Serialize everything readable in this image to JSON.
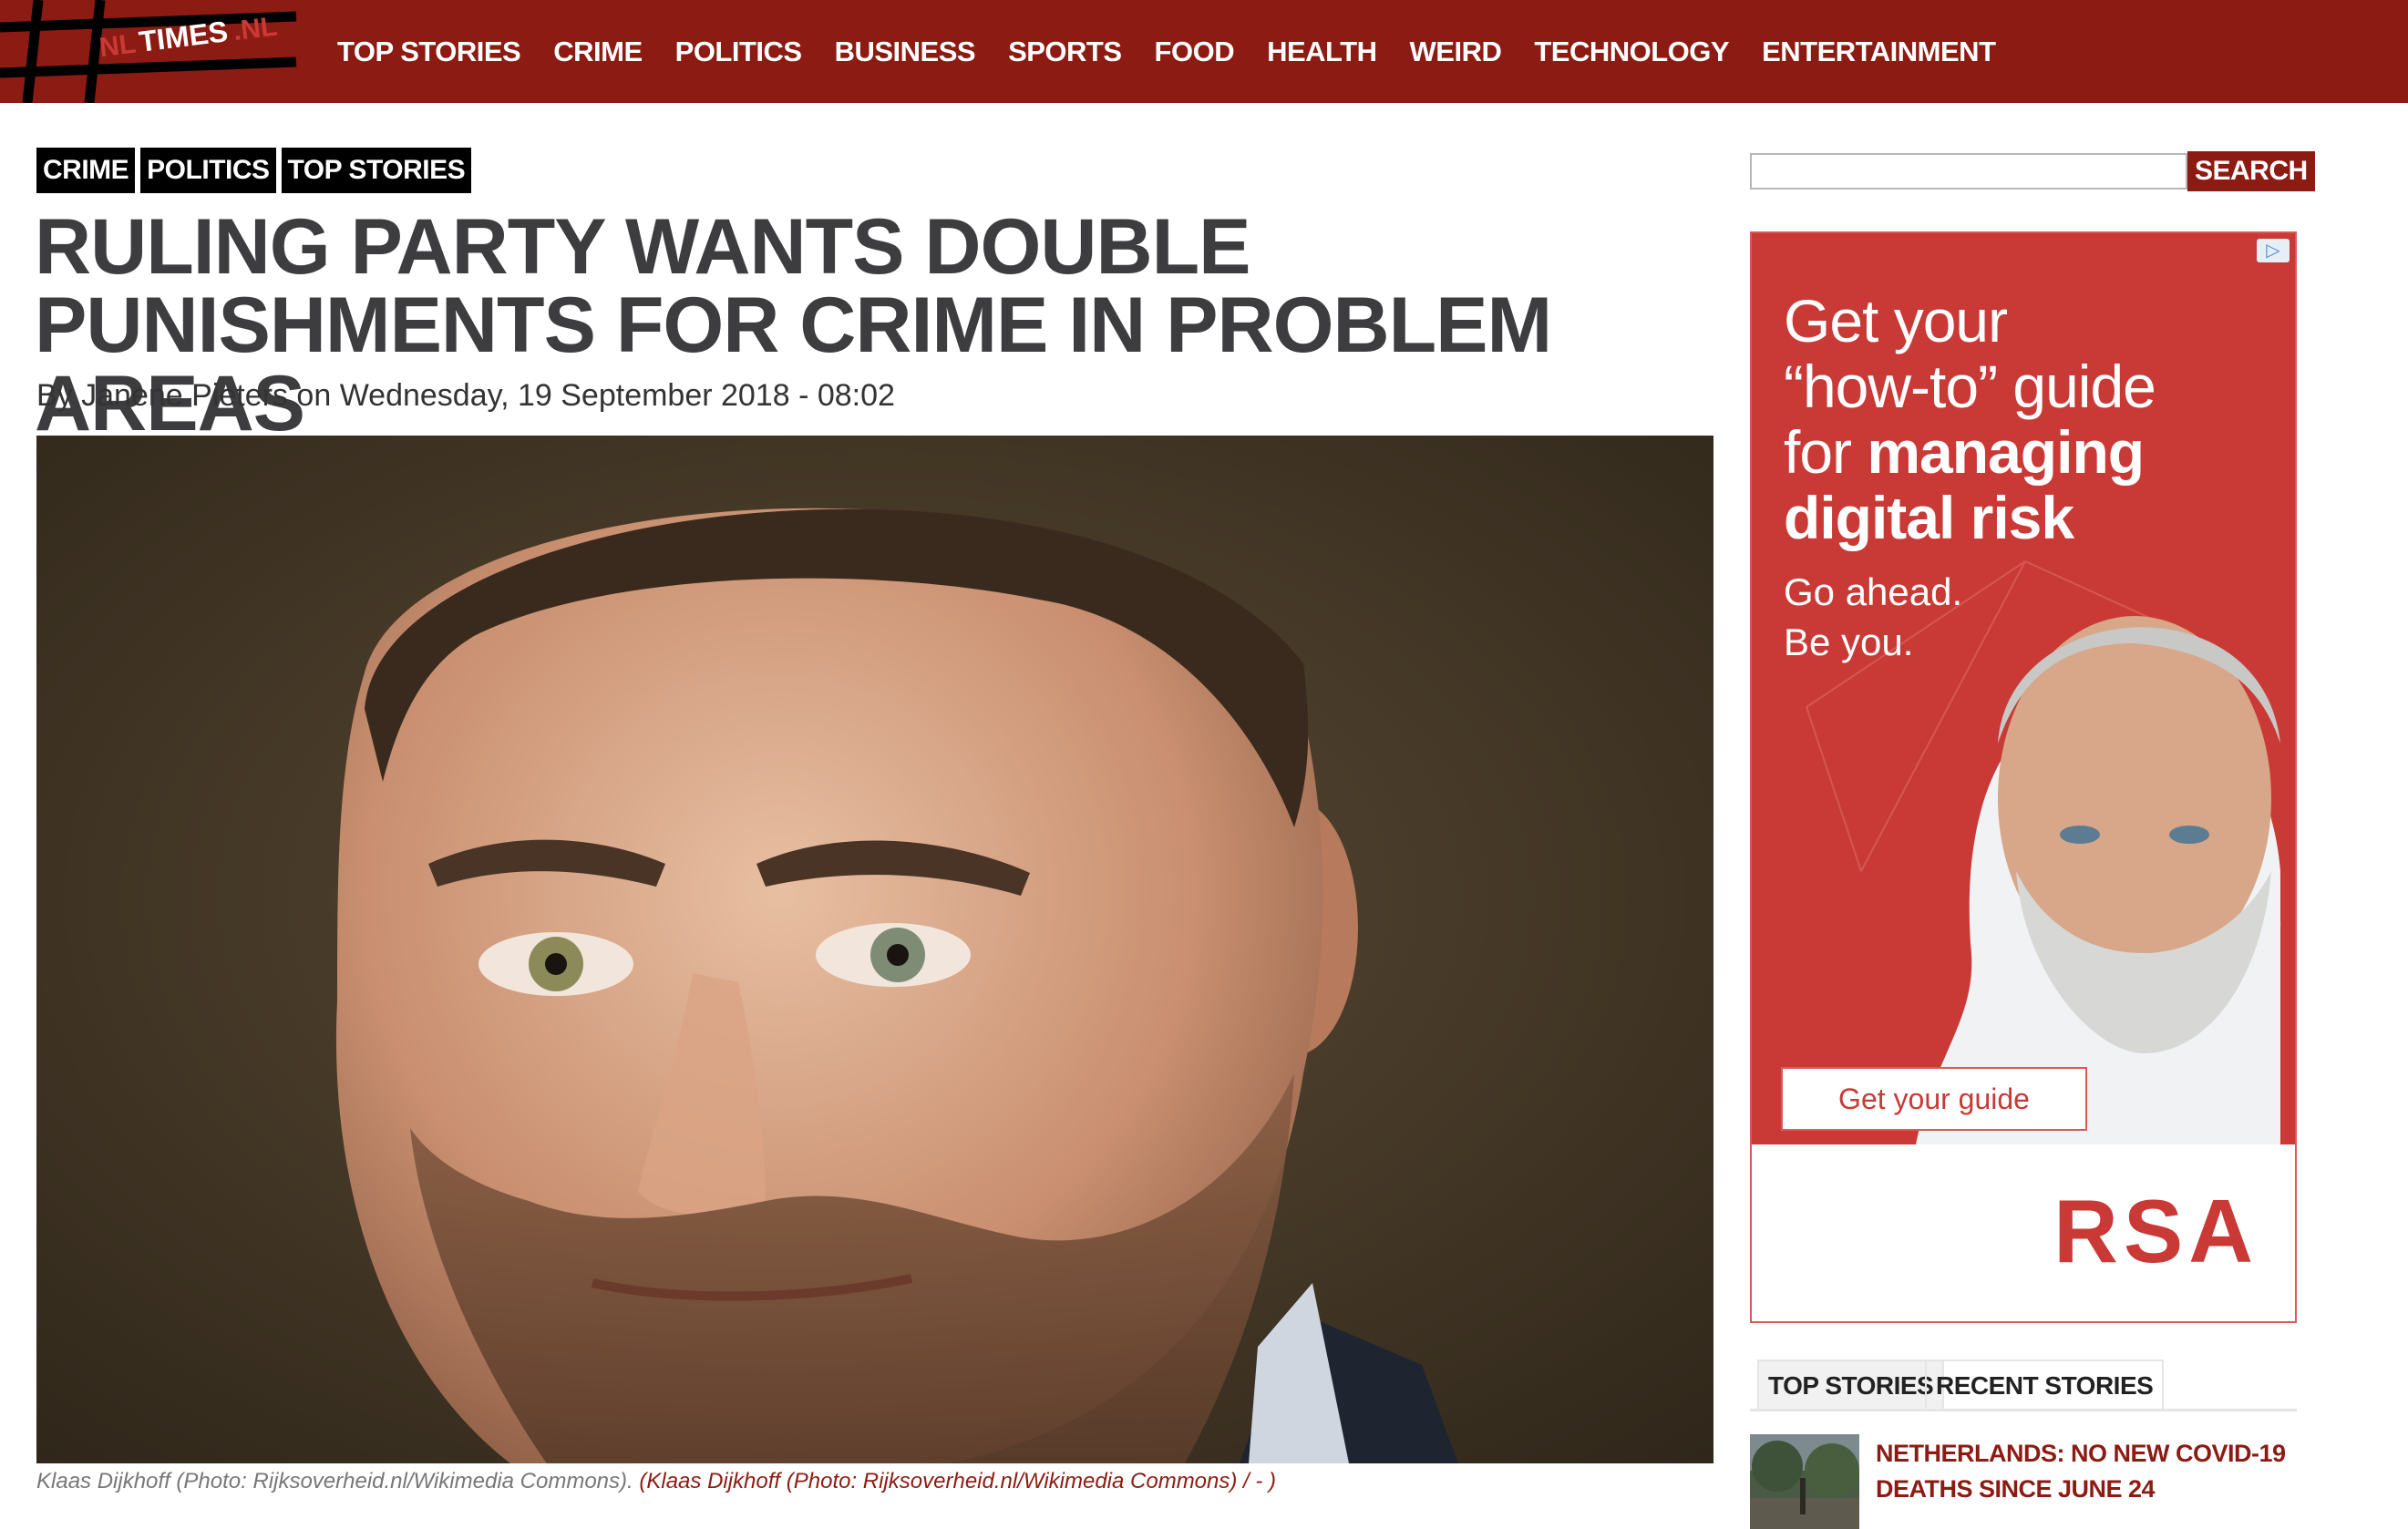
{
  "site": {
    "logo_prefix": "NL",
    "logo_main": "TIMES",
    "logo_suffix": ".NL"
  },
  "nav": {
    "items": [
      "TOP STORIES",
      "CRIME",
      "POLITICS",
      "BUSINESS",
      "SPORTS",
      "FOOD",
      "HEALTH",
      "WEIRD",
      "TECHNOLOGY",
      "ENTERTAINMENT"
    ]
  },
  "article": {
    "tags": [
      "CRIME",
      "POLITICS",
      "TOP STORIES"
    ],
    "headline": "RULING PARTY WANTS DOUBLE PUNISHMENTS FOR CRIME IN PROBLEM AREAS",
    "byline": {
      "prefix": "By",
      "author": "Janene Pieters",
      "on": "on",
      "date": "Wednesday, 19 September 2018 - 08:02"
    },
    "caption": {
      "text": "Klaas Dijkhoff (Photo: Rijksoverheid.nl/Wikimedia Commons).",
      "open": "(",
      "link": "Klaas Dijkhoff (Photo: Rijksoverheid.nl/Wikimedia Commons) / - )"
    }
  },
  "sidebar": {
    "search": {
      "placeholder": "",
      "button_label": "SEARCH"
    },
    "ad": {
      "line1": "Get your",
      "line2": "“how-to” guide",
      "line3_light": "for",
      "line3_bold": "managing",
      "line4": "digital risk",
      "sub1": "Go ahead.",
      "sub2": "Be you.",
      "cta": "Get your guide",
      "brand": "RSA",
      "adchoices": "▷"
    },
    "tabs": [
      "TOP STORIES",
      "RECENT STORIES"
    ],
    "stories": [
      {
        "title": "NETHERLANDS: NO NEW COVID-19 DEATHS SINCE JUNE 24"
      }
    ]
  },
  "colors": {
    "brand_red": "#8c1c13",
    "ad_red": "#c93a36",
    "headline_gray": "#3d3d3f"
  }
}
